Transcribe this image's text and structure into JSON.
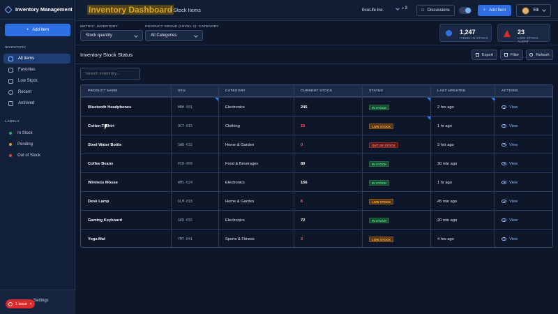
{
  "app": {
    "name": "Inventory Management"
  },
  "sidebar": {
    "add_label": "Add Item",
    "inventory_heading": "INVENTORY",
    "items": [
      {
        "label": "All Items",
        "icon": "cube-icon",
        "active": true
      },
      {
        "label": "Favorites",
        "icon": "star-icon",
        "active": false
      },
      {
        "label": "Low Stock",
        "icon": "truck-icon",
        "active": false
      },
      {
        "label": "Recent",
        "icon": "clock-icon",
        "active": false
      },
      {
        "label": "Archived",
        "icon": "archive-icon",
        "active": false
      }
    ],
    "labels_heading": "LABELS",
    "labels": [
      {
        "label": "In Stock",
        "color": "#2fb36f"
      },
      {
        "label": "Pending",
        "color": "#e49b2b"
      },
      {
        "label": "Out of Stock",
        "color": "#e04848"
      }
    ],
    "settings_label": "Settings",
    "issue_label": "1 Issue"
  },
  "header": {
    "title": "Inventory Dashboard",
    "subtitle": "• Stock Items",
    "company": "EcoLife Inc.",
    "notifications": "3",
    "discussions_label": "Discussions",
    "add_item_label": "Add Item",
    "user_name": "Elli"
  },
  "filters": {
    "metric_label": "METRIC: INVENTORY",
    "metric_value": "Stock quantity",
    "group_label": "PRODUCT GROUP (LEVEL 1): CATEGORY",
    "group_value": "All Categories"
  },
  "stats": [
    {
      "value": "1,247",
      "label": "ITEMS IN STOCK",
      "color": "#2f6fe4"
    },
    {
      "value": "23",
      "label": "LOW STOCK ALERT",
      "color": "#d92c2c"
    }
  ],
  "panel": {
    "title": "Inventory Stock Status",
    "export_label": "Export",
    "filter_label": "Filter",
    "refresh_label": "Refresh"
  },
  "search": {
    "placeholder": "Search inventory..."
  },
  "table": {
    "columns": [
      "PRODUCT NAME",
      "SKU",
      "CATEGORY",
      "CURRENT STOCK",
      "STATUS",
      "LAST UPDATED",
      "ACTIONS"
    ],
    "rows": [
      {
        "name": "Bluetooth Headphones",
        "sku": "WBH-001",
        "category": "Electronics",
        "stock": "245",
        "status": "IN STOCK",
        "updated": "2 hrs ago",
        "action": "View"
      },
      {
        "name": "Cotton T-Shirt",
        "sku": "OCT-015",
        "category": "Clothing",
        "stock": "15",
        "status": "LOW STOCK",
        "updated": "1 hr ago",
        "action": "View"
      },
      {
        "name": "Steel Water Bottle",
        "sku": "SWB-032",
        "category": "Home & Garden",
        "stock": "0",
        "status": "OUT OF STOCK",
        "updated": "3 hrs ago",
        "action": "View"
      },
      {
        "name": "Coffee Beans",
        "sku": "PCB-009",
        "category": "Food & Beverages",
        "stock": "89",
        "status": "IN STOCK",
        "updated": "30 min ago",
        "action": "View"
      },
      {
        "name": "Wireless Mouse",
        "sku": "WMS-024",
        "category": "Electronics",
        "stock": "156",
        "status": "IN STOCK",
        "updated": "1 hr ago",
        "action": "View"
      },
      {
        "name": "Desk Lamp",
        "sku": "DLM-018",
        "category": "Home & Garden",
        "stock": "8",
        "status": "LOW STOCK",
        "updated": "45 min ago",
        "action": "View"
      },
      {
        "name": "Gaming Keyboard",
        "sku": "GKB-055",
        "category": "Electronics",
        "stock": "72",
        "status": "IN STOCK",
        "updated": "20 min ago",
        "action": "View"
      },
      {
        "name": "Yoga Mat",
        "sku": "YMT-041",
        "category": "Sports & Fitness",
        "stock": "3",
        "status": "LOW STOCK",
        "updated": "4 hrs ago",
        "action": "View"
      }
    ]
  }
}
